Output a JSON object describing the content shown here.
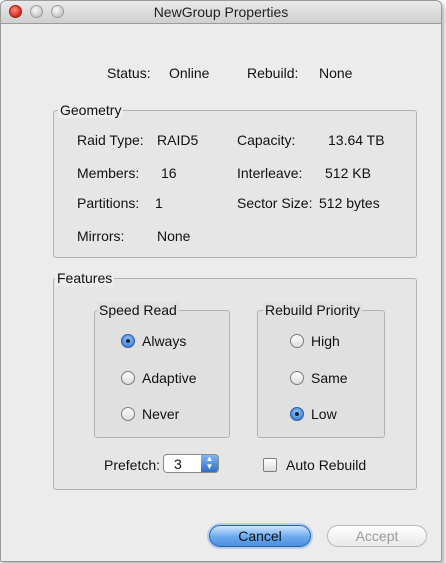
{
  "window": {
    "title": "NewGroup Properties"
  },
  "status": {
    "status_label": "Status:",
    "status_value": "Online",
    "rebuild_label": "Rebuild:",
    "rebuild_value": "None"
  },
  "geometry": {
    "legend": "Geometry",
    "raid_type_label": "Raid Type:",
    "raid_type_value": "RAID5",
    "capacity_label": "Capacity:",
    "capacity_value": "13.64 TB",
    "members_label": "Members:",
    "members_value": "16",
    "interleave_label": "Interleave:",
    "interleave_value": "512 KB",
    "partitions_label": "Partitions:",
    "partitions_value": "1",
    "sector_size_label": "Sector Size:",
    "sector_size_value": "512 bytes",
    "mirrors_label": "Mirrors:",
    "mirrors_value": "None"
  },
  "features": {
    "legend": "Features",
    "speed_read": {
      "legend": "Speed Read",
      "options": [
        "Always",
        "Adaptive",
        "Never"
      ],
      "selected": "Always"
    },
    "rebuild_priority": {
      "legend": "Rebuild Priority",
      "options": [
        "High",
        "Same",
        "Low"
      ],
      "selected": "Low"
    },
    "prefetch_label": "Prefetch:",
    "prefetch_value": "3",
    "auto_rebuild_label": "Auto Rebuild",
    "auto_rebuild_checked": false
  },
  "buttons": {
    "cancel": "Cancel",
    "accept": "Accept"
  },
  "colors": {
    "accent": "#4c8fe0",
    "close": "#d32a1f"
  }
}
